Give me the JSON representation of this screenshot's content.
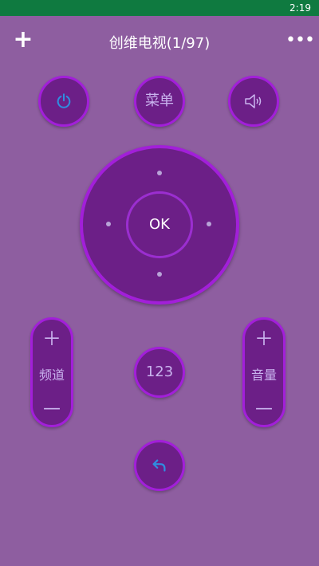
{
  "status_bar": {
    "time": "2:19"
  },
  "toolbar": {
    "title": "创维电视(1/97)"
  },
  "buttons": {
    "menu_label": "菜单",
    "ok_label": "OK",
    "numbers_label": "123"
  },
  "channel": {
    "label": "频道"
  },
  "volume": {
    "label": "音量"
  },
  "icons": {
    "add": "plus-icon",
    "more": "more-horizontal-icon",
    "power": "power-icon",
    "mute": "speaker-mute-icon",
    "back": "back-arrow-icon"
  },
  "colors": {
    "background": "#8e5ea0",
    "button_fill": "#6c1f87",
    "button_border": "#a21fd9",
    "accent_blue": "#2f8de0"
  }
}
